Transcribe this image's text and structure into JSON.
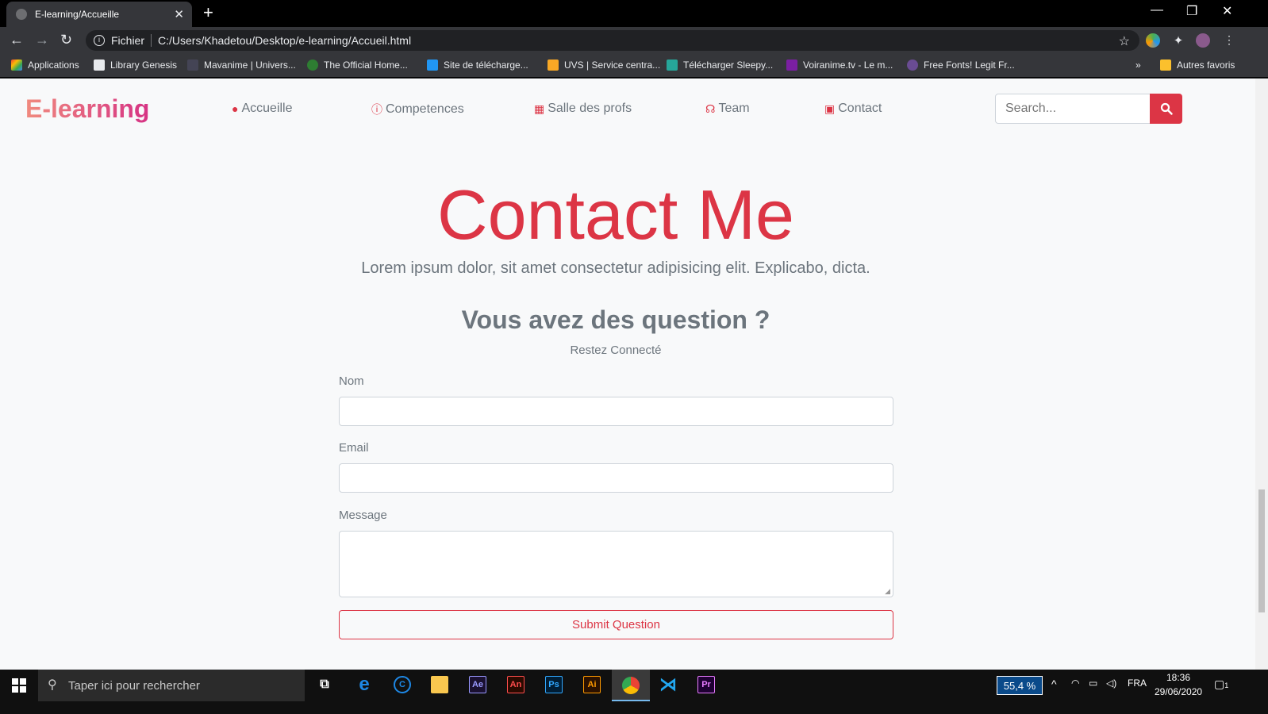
{
  "browser": {
    "tab_title": "E-learning/Accueille",
    "address_prefix": "Fichier",
    "url": "C:/Users/Khadetou/Desktop/e-learning/Accueil.html",
    "bookmarks": [
      "Applications",
      "Library Genesis",
      "Mavanime | Univers...",
      "The Official Home...",
      "Site de télécharge...",
      "UVS | Service centra...",
      "Télécharger Sleepy...",
      "Voiranime.tv - Le m...",
      "Free Fonts! Legit Fr...",
      "Autres favoris"
    ],
    "more_bookmarks": "»"
  },
  "navbar": {
    "brand": "E-learning",
    "items": [
      "Accueille",
      "Competences",
      "Salle des profs",
      "Team",
      "Contact"
    ],
    "search_placeholder": "Search..."
  },
  "hero": {
    "title": "Contact Me",
    "subtitle": "Lorem ipsum dolor, sit amet consectetur adipisicing elit. Explicabo, dicta."
  },
  "form": {
    "heading": "Vous avez des question ?",
    "subheading": "Restez Connecté",
    "name_label": "Nom",
    "email_label": "Email",
    "message_label": "Message",
    "submit_label": "Submit Question"
  },
  "taskbar": {
    "search_placeholder": "Taper ici pour rechercher",
    "apps": [
      "Ae",
      "An",
      "Ps",
      "Ai",
      "Pr"
    ],
    "zoom": "55,4 %",
    "language": "FRA",
    "time": "18:36",
    "date": "29/06/2020",
    "notifications": "1"
  },
  "colors": {
    "accent": "#dc3545",
    "muted": "#6c757d",
    "page_bg": "#f8f9fa"
  }
}
